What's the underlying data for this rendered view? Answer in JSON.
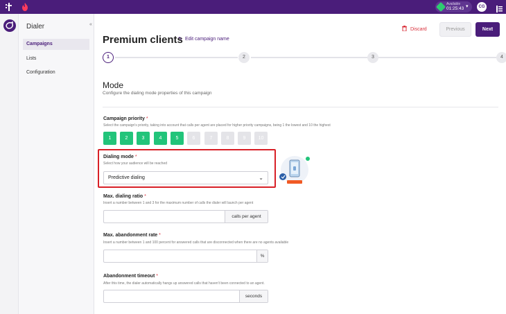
{
  "topbar": {
    "logo_text": "t",
    "status_label": "Available",
    "status_time": "01:25:43",
    "avatar_initials": "CG"
  },
  "sidebar": {
    "title": "Dialer",
    "collapse_icon": "«",
    "items": [
      {
        "label": "Campaigns",
        "active": true
      },
      {
        "label": "Lists",
        "active": false
      },
      {
        "label": "Configuration",
        "active": false
      }
    ]
  },
  "header": {
    "title": "Premium clients",
    "edit_label": "Edit campaign name",
    "discard_label": "Discard",
    "previous_label": "Previous",
    "next_label": "Next"
  },
  "stepper": {
    "steps": [
      "1",
      "2",
      "3",
      "4"
    ],
    "current": 1
  },
  "mode": {
    "title": "Mode",
    "description": "Configure the dialing mode properties of this campaign"
  },
  "priority": {
    "label": "Campaign priority",
    "required": "*",
    "help": "Select the campaign's priority, taking into account that calls per agent are placed for higher priority campaigns, being 1 the lowest and 10 the highest",
    "values": [
      "1",
      "2",
      "3",
      "4",
      "5",
      "6",
      "7",
      "8",
      "9",
      "10"
    ],
    "selected": 5
  },
  "dialing_mode": {
    "label": "Dialing mode",
    "required": "*",
    "help": "Select how your audience will be reached",
    "value": "Predictive dialing"
  },
  "ratio": {
    "label": "Max. dialing ratio",
    "required": "*",
    "help": "Insert a number between 1 and 3 for the maximum number of calls the dialer will launch per agent",
    "value": "",
    "suffix": "calls per agent"
  },
  "abandonment": {
    "label": "Max. abandonment rate",
    "required": "*",
    "help": "Insert a number between 1 and 100 percent for answered calls that are disconnected when there are no agents available",
    "value": "",
    "suffix": "%"
  },
  "timeout": {
    "label": "Abandonment timeout",
    "required": "*",
    "help": "After this time, the dialer automatically hangs up answered calls that haven't been connected to an agent.",
    "value": "",
    "suffix": "seconds"
  },
  "colors": {
    "brand": "#4a1d7a",
    "priority_on": "#22c47a",
    "priority_off": "#e4e4e8",
    "danger": "#d9303b",
    "highlight": "#d81f26"
  }
}
